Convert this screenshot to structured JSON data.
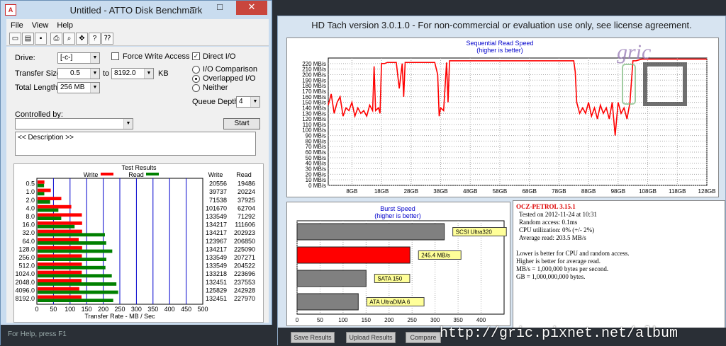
{
  "atto": {
    "title": "Untitled - ATTO Disk Benchmark",
    "menu": [
      "File",
      "View",
      "Help"
    ],
    "drive_label": "Drive:",
    "drive_value": "[-c-]",
    "force_write_label": "Force Write Access",
    "direct_io_label": "Direct I/O",
    "transfer_size_label": "Transfer Size:",
    "transfer_from": "0.5",
    "to_label": "to",
    "transfer_to": "8192.0",
    "kb_label": "KB",
    "total_length_label": "Total Length:",
    "total_length_value": "256 MB",
    "io_comparison_label": "I/O Comparison",
    "overlapped_label": "Overlapped I/O",
    "neither_label": "Neither",
    "queue_depth_label": "Queue Depth:",
    "queue_depth_value": "4",
    "controlled_by_label": "Controlled by:",
    "start_label": "Start",
    "description": "<< Description >>",
    "test_results_label": "Test Results",
    "write_label": "Write",
    "read_label": "Read",
    "col_write": "Write",
    "col_read": "Read",
    "xlabel": "Transfer Rate - MB / Sec",
    "status": "For Help, press F1"
  },
  "hdtach": {
    "title": "HD Tach version 3.0.1.0  - For non-commercial or evaluation use only, see license agreement.",
    "seq_title": "Sequential Read Speed",
    "seq_subtitle": "(higher is better)",
    "burst_title": "Burst Speed",
    "burst_subtitle": "(higher is better)",
    "info_title": "OCZ-PETROL 3.15.1",
    "info_lines": [
      "Tested on 2012-11-24 at 10:31",
      "Random access: 0.1ms",
      "CPU utilization: 0% (+/- 2%)",
      "Average read: 203.5 MB/s",
      "",
      "Lower is better for CPU and random access.",
      "Higher is better for average read.",
      "MB/s = 1,000,000 bytes per second.",
      "GB = 1,000,000,000 bytes."
    ],
    "buttons": [
      "Save Results",
      "Upload Results",
      "Compare"
    ]
  },
  "watermark": "http://gric.pixnet.net/album",
  "chart_data": [
    {
      "type": "bar",
      "title": "Test Results",
      "xlabel": "Transfer Rate - MB / Sec",
      "xlim": [
        0,
        500
      ],
      "ticks": [
        0,
        50,
        100,
        150,
        200,
        250,
        300,
        350,
        400,
        450,
        500
      ],
      "categories": [
        "0.5",
        "1.0",
        "2.0",
        "4.0",
        "8.0",
        "16.0",
        "32.0",
        "64.0",
        "128.0",
        "256.0",
        "512.0",
        "1024.0",
        "2048.0",
        "4096.0",
        "8192.0"
      ],
      "series": [
        {
          "name": "Write",
          "color": "#ff0000",
          "values": [
            20556,
            39737,
            71538,
            101670,
            133549,
            134217,
            134217,
            123967,
            134217,
            133549,
            133549,
            133218,
            132451,
            125829,
            132451
          ]
        },
        {
          "name": "Read",
          "color": "#008000",
          "values": [
            19486,
            20224,
            37925,
            62704,
            71292,
            111606,
            202923,
            206850,
            225090,
            207271,
            204522,
            223696,
            237553,
            242928,
            227970
          ]
        }
      ]
    },
    {
      "type": "line",
      "title": "Sequential Read Speed",
      "subtitle": "(higher is better)",
      "xlim": [
        0,
        128
      ],
      "ylim": [
        0,
        230
      ],
      "xticks": [
        "8GB",
        "18GB",
        "28GB",
        "38GB",
        "48GB",
        "58GB",
        "68GB",
        "78GB",
        "88GB",
        "98GB",
        "108GB",
        "118GB",
        "128GB"
      ],
      "yticks": [
        "0 MB/s",
        "10 MB/s",
        "20 MB/s",
        "30 MB/s",
        "40 MB/s",
        "50 MB/s",
        "60 MB/s",
        "70 MB/s",
        "80 MB/s",
        "90 MB/s",
        "100 MB/s",
        "110 MB/s",
        "120 MB/s",
        "130 MB/s",
        "140 MB/s",
        "150 MB/s",
        "160 MB/s",
        "170 MB/s",
        "180 MB/s",
        "190 MB/s",
        "200 MB/s",
        "210 MB/s",
        "220 MB/s"
      ],
      "series": [
        {
          "color": "#ff0000",
          "x": [
            0,
            1,
            2,
            3,
            4,
            5,
            6,
            7,
            8,
            9,
            10,
            11,
            12,
            13,
            14,
            15,
            15.5,
            16,
            17,
            17.5,
            18,
            19,
            20,
            22,
            23,
            24,
            25,
            25.5,
            26,
            27,
            28,
            30,
            32,
            34,
            36,
            37,
            37.5,
            38,
            39,
            40,
            40.5,
            41,
            42,
            44,
            48,
            52,
            56,
            60,
            64,
            68,
            72,
            76,
            80,
            82,
            83,
            83.5,
            84,
            85,
            86,
            87,
            88,
            89,
            90,
            91,
            92,
            93,
            94,
            95,
            96,
            97,
            98,
            99,
            100,
            101,
            102,
            103,
            104,
            106,
            108,
            110,
            112,
            116,
            120,
            124,
            128
          ],
          "y": [
            145,
            165,
            130,
            150,
            160,
            125,
            140,
            135,
            150,
            125,
            140,
            130,
            135,
            125,
            145,
            135,
            215,
            135,
            140,
            130,
            220,
            220,
            222,
            222,
            222,
            175,
            220,
            160,
            222,
            222,
            222,
            222,
            222,
            222,
            222,
            200,
            125,
            140,
            135,
            222,
            150,
            225,
            225,
            225,
            225,
            225,
            225,
            225,
            225,
            225,
            225,
            225,
            225,
            225,
            225,
            205,
            150,
            130,
            140,
            130,
            150,
            125,
            140,
            120,
            145,
            130,
            140,
            120,
            150,
            90,
            150,
            130,
            140,
            120,
            150,
            225,
            225,
            228,
            228,
            228,
            228,
            228,
            228,
            228,
            228
          ]
        }
      ]
    },
    {
      "type": "bar",
      "title": "Burst Speed",
      "subtitle": "(higher is better)",
      "xlim": [
        0,
        450
      ],
      "ticks": [
        0,
        50,
        100,
        150,
        200,
        250,
        300,
        350,
        400
      ],
      "categories": [
        "SCSI Ultra320",
        "245.4 MB/s",
        "SATA 150",
        "ATA UltraDMA 6"
      ],
      "values": [
        320,
        245.4,
        150,
        133
      ],
      "colors": [
        "#808080",
        "#ff0000",
        "#808080",
        "#808080"
      ]
    }
  ]
}
